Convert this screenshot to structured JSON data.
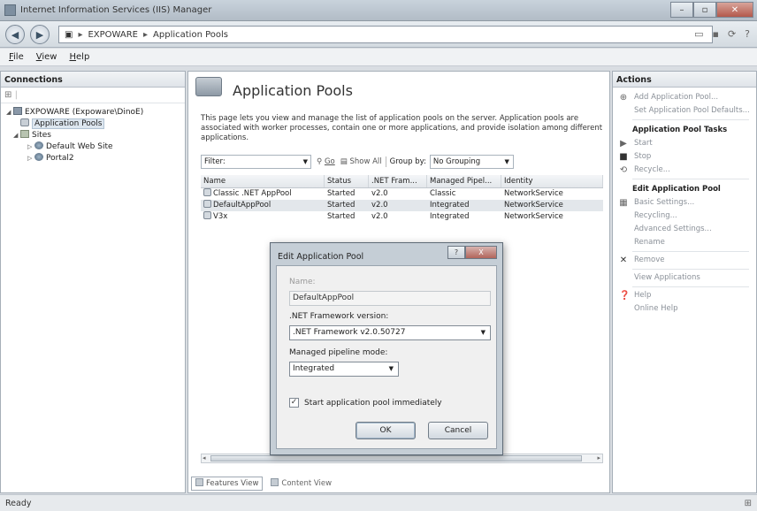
{
  "window": {
    "title": "Internet Information Services (IIS) Manager"
  },
  "address": {
    "segments": [
      "EXPOWARE",
      "Application Pools"
    ]
  },
  "menu": [
    {
      "key": "F",
      "rest": "ile"
    },
    {
      "key": "V",
      "rest": "iew"
    },
    {
      "key": "H",
      "rest": "elp"
    }
  ],
  "connections": {
    "title": "Connections",
    "tree": [
      {
        "label": "EXPOWARE (Expoware\\DinoE)",
        "icon": "server-icon"
      },
      {
        "label": "Application Pools",
        "icon": "app-pool-icon"
      },
      {
        "label": "Sites",
        "icon": "sites-folder-icon"
      },
      {
        "label": "Default Web Site",
        "icon": "globe-icon"
      },
      {
        "label": "Portal2",
        "icon": "globe-icon"
      }
    ]
  },
  "main": {
    "title": "Application Pools",
    "description": "This page lets you view and manage the list of application pools on the server. Application pools are associated with worker processes, contain one or more applications, and provide isolation among different applications.",
    "filter_label": "Filter:",
    "go_label": "Go",
    "show_all_label": "Show All",
    "group_by_label": "Group by:",
    "group_by_value": "No Grouping",
    "columns": [
      "Name",
      "Status",
      ".NET Fram...",
      "Managed Pipel...",
      "Identity"
    ],
    "rows": [
      {
        "name": "Classic .NET AppPool",
        "status": "Started",
        "net": "v2.0",
        "pipeline": "Classic",
        "identity": "NetworkService"
      },
      {
        "name": "DefaultAppPool",
        "status": "Started",
        "net": "v2.0",
        "pipeline": "Integrated",
        "identity": "NetworkService"
      },
      {
        "name": "V3x",
        "status": "Started",
        "net": "v2.0",
        "pipeline": "Integrated",
        "identity": "NetworkService"
      }
    ],
    "tabs": {
      "features": "Features View",
      "content": "Content View"
    }
  },
  "actions": {
    "title": "Actions",
    "add_pool": "Add Application Pool...",
    "set_defaults": "Set Application Pool Defaults...",
    "tasks_header": "Application Pool Tasks",
    "start": "Start",
    "stop": "Stop",
    "recycle": "Recycle...",
    "edit_header": "Edit Application Pool",
    "basic_settings": "Basic Settings...",
    "recycling": "Recycling...",
    "advanced_settings": "Advanced Settings...",
    "rename": "Rename",
    "remove": "Remove",
    "view_applications": "View Applications",
    "help": "Help",
    "online_help": "Online Help"
  },
  "dialog": {
    "title": "Edit Application Pool",
    "help_btn": "?",
    "close_btn": "X",
    "name_label": "Name:",
    "name_value": "DefaultAppPool",
    "framework_label": ".NET Framework version:",
    "framework_value": ".NET Framework v2.0.50727",
    "pipeline_label": "Managed pipeline mode:",
    "pipeline_value": "Integrated",
    "start_check_label": "Start application pool immediately",
    "start_checked": true,
    "ok": "OK",
    "cancel": "Cancel"
  },
  "status": {
    "text": "Ready"
  }
}
